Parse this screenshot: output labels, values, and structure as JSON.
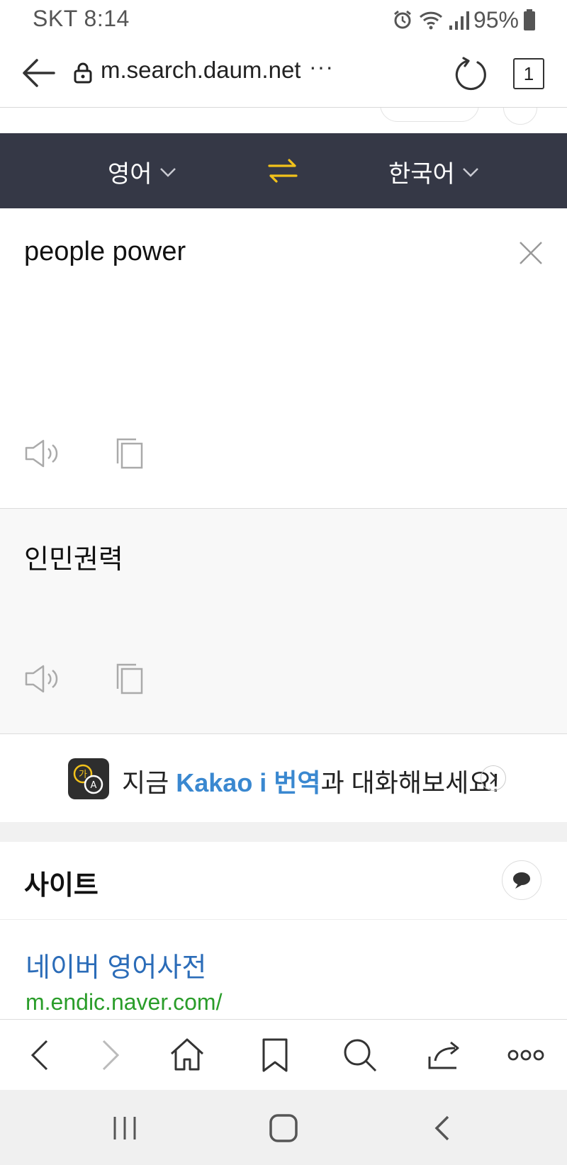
{
  "status_bar": {
    "carrier_time": "SKT 8:14",
    "battery": "95%",
    "icons": [
      "alarm-icon",
      "wifi-icon",
      "signal-icon",
      "battery-icon"
    ]
  },
  "url_bar": {
    "url": "m.search.daum.net",
    "more": "···",
    "tab_count": "1"
  },
  "translator": {
    "source_lang": "영어",
    "target_lang": "한국어",
    "input_text": "people power",
    "output_text": "인민권력"
  },
  "promo": {
    "prefix": "지금 ",
    "highlight": "Kakao i 번역",
    "suffix": "과 대화해보세요!",
    "icon_glyph_top": "가",
    "icon_glyph_bottom": "A"
  },
  "site_section": {
    "title": "사이트",
    "results": [
      {
        "title": "네이버 영어사전",
        "url": "m.endic.naver.com/"
      }
    ]
  },
  "colors": {
    "lang_bar": "#353846",
    "swap_accent": "#f2c21b",
    "link": "#2b6cb8",
    "url_green": "#2a9d2a",
    "promo_highlight": "#3a88d0"
  }
}
